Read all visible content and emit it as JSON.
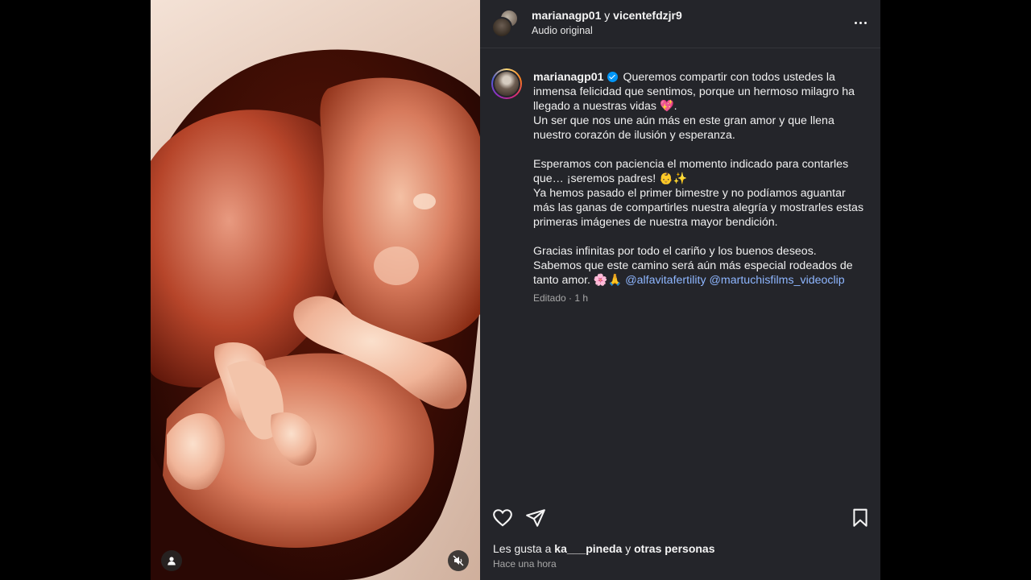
{
  "post": {
    "header": {
      "user_one": "marianagp01",
      "joiner": "y",
      "user_two": "vicentefdzjr9",
      "audio": "Audio original"
    },
    "caption": {
      "username": "marianagp01",
      "p1_l1": "Queremos compartir con todos ustedes la",
      "p1_l2": "inmensa felicidad que sentimos, porque un hermoso milagro ha",
      "p1_l3": "llegado a nuestras vidas 💖.",
      "p1_l4": "Un ser que nos une aún más en este gran amor y que llena",
      "p1_l5": "nuestro corazón de ilusión y esperanza.",
      "p2_l1": "Esperamos con paciencia el momento indicado para contarles",
      "p2_l2": "que… ¡seremos padres! 👶✨",
      "p2_l3": "Ya hemos pasado el primer bimestre y no podíamos aguantar",
      "p2_l4": "más las ganas de compartirles nuestra alegría y mostrarles estas",
      "p2_l5": "primeras imágenes de nuestra mayor bendición.",
      "p3_l1": "Gracias infinitas por todo el cariño y los buenos deseos.",
      "p3_l2": "Sabemos que este camino será aún más especial rodeados de",
      "p3_l3": "tanto amor. 🌸🙏",
      "mention_one": "@alfavitafertility",
      "mention_two": "@martuchisfilms_videoclip",
      "meta": "Editado · 1 h"
    },
    "icons": {
      "like": "heart-icon",
      "share": "paper-plane-icon",
      "save": "bookmark-icon",
      "more": "more-horizontal-icon",
      "tag": "user-tag-icon",
      "mute": "speaker-muted-icon"
    },
    "likes": {
      "prefix": "Les gusta a",
      "user": "ka___pineda",
      "joiner": "y",
      "others": "otras personas"
    },
    "timestamp": "Hace una hora"
  }
}
